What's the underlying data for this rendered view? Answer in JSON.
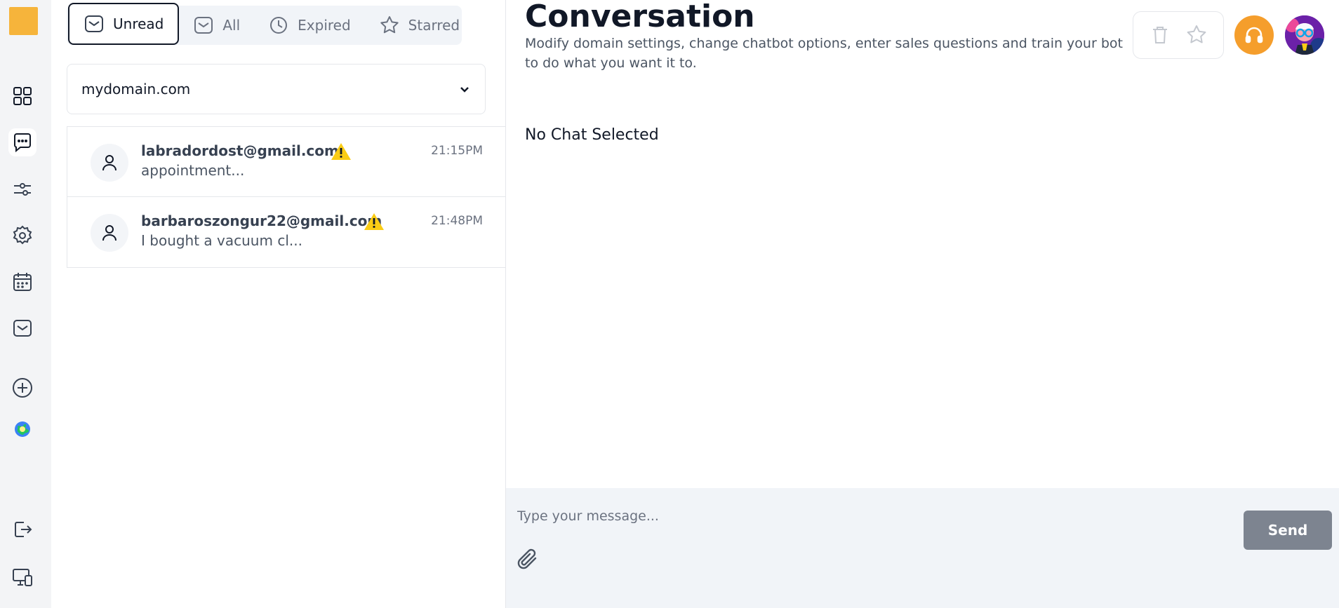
{
  "tabs": [
    {
      "label": "Unread",
      "icon": "inbox-icon",
      "active": true
    },
    {
      "label": "All",
      "icon": "inbox-icon",
      "active": false
    },
    {
      "label": "Expired",
      "icon": "clock-icon",
      "active": false
    },
    {
      "label": "Starred",
      "icon": "star-icon",
      "active": false
    }
  ],
  "domain_select": {
    "value": "mydomain.com"
  },
  "conversations": [
    {
      "email": "labradordost@gmail.com",
      "preview": "appointment...",
      "time": "21:15PM",
      "warning": true
    },
    {
      "email": "barbaroszongur22@gmail.com",
      "preview": "I bought a vacuum cl...",
      "time": "21:48PM",
      "warning": true
    }
  ],
  "header": {
    "title": "Conversation",
    "subtitle": "Modify domain settings, change chatbot options, enter sales questions and train your bot to do what you want it to."
  },
  "empty_state": "No Chat Selected",
  "composer": {
    "placeholder": "Type your message...",
    "send_label": "Send"
  },
  "colors": {
    "accent": "#f59e2c",
    "send_button": "#7d8490",
    "warning": "#facc15"
  },
  "sidebar_icons": [
    "dashboard-icon",
    "chat-icon",
    "settings-sliders-icon",
    "gear-icon",
    "calendar-icon",
    "inbox-icon",
    "plus-icon",
    "globe-icon",
    "logout-icon",
    "devices-icon"
  ]
}
